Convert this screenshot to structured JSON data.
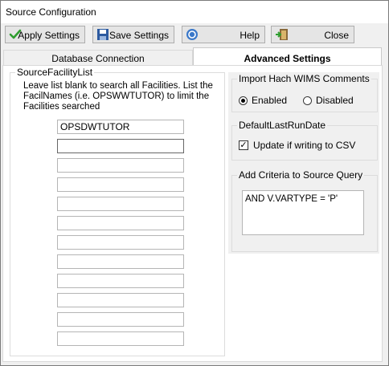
{
  "window": {
    "title": "Source Configuration"
  },
  "toolbar": {
    "apply_label": "Apply Settings",
    "save_label": "Save Settings",
    "help_label": "Help",
    "close_label": "Close"
  },
  "tabs": [
    {
      "label": "Database Connection",
      "selected": false
    },
    {
      "label": "Advanced Settings",
      "selected": true
    }
  ],
  "facility": {
    "legend": "SourceFacilityList",
    "hint": "Leave list blank to search all Facilities.  List  the FacilNames (i.e. OPSWWTUTOR)  to limit the Facilities searched",
    "values": [
      "OPSDWTUTOR",
      "",
      "",
      "",
      "",
      "",
      "",
      "",
      "",
      "",
      "",
      ""
    ]
  },
  "import": {
    "legend": "Import Hach WIMS Comments",
    "enabled_label": "Enabled",
    "disabled_label": "Disabled",
    "selected": "Enabled"
  },
  "lastrun": {
    "legend": "DefaultLastRunDate",
    "update_label": "Update if writing to CSV",
    "checked": true
  },
  "criteria": {
    "legend": "Add Criteria to Source Query",
    "value": "AND V.VARTYPE = 'P'"
  },
  "icons": {
    "apply": "checkmark-icon",
    "save": "floppy-disk-icon",
    "help": "help-icon",
    "close": "exit-door-icon"
  }
}
